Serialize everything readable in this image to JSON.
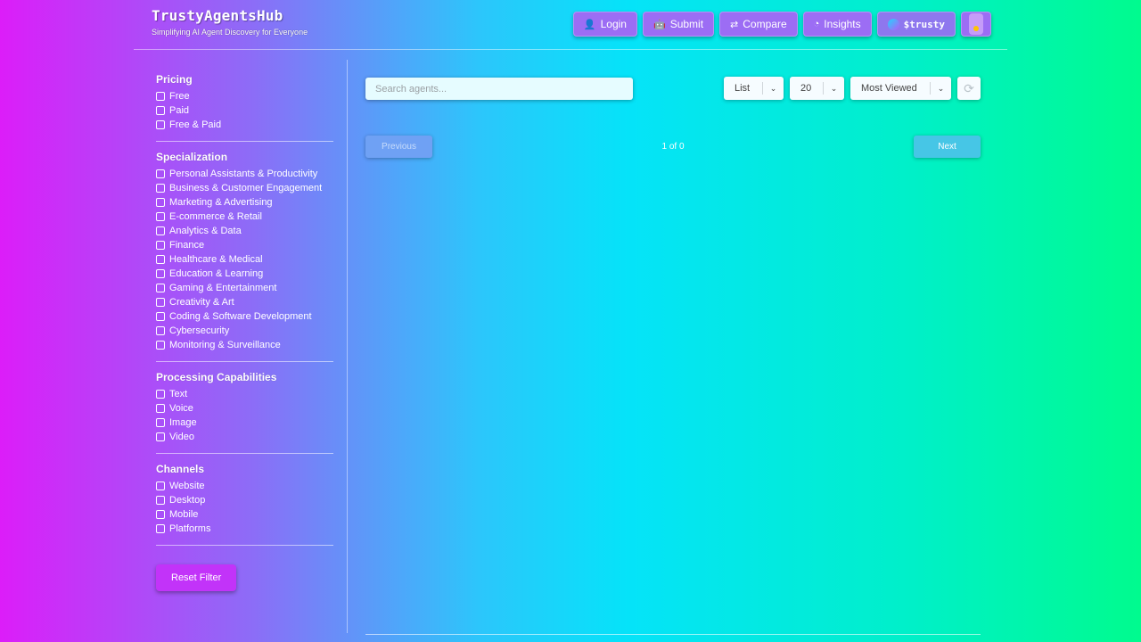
{
  "brand": {
    "title": "TrustyAgentsHub",
    "subtitle": "Simplifying AI Agent Discovery for Everyone"
  },
  "nav": {
    "login": "Login",
    "submit": "Submit",
    "compare": "Compare",
    "insights": "Insights",
    "trusty": "$trusty"
  },
  "filters": {
    "pricing": {
      "title": "Pricing",
      "options": [
        "Free",
        "Paid",
        "Free & Paid"
      ]
    },
    "specialization": {
      "title": "Specialization",
      "options": [
        "Personal Assistants & Productivity",
        "Business & Customer Engagement",
        "Marketing & Advertising",
        "E-commerce & Retail",
        "Analytics & Data",
        "Finance",
        "Healthcare & Medical",
        "Education & Learning",
        "Gaming & Entertainment",
        "Creativity & Art",
        "Coding & Software Development",
        "Cybersecurity",
        "Monitoring & Surveillance"
      ]
    },
    "processing": {
      "title": "Processing Capabilities",
      "options": [
        "Text",
        "Voice",
        "Image",
        "Video"
      ]
    },
    "channels": {
      "title": "Channels",
      "options": [
        "Website",
        "Desktop",
        "Mobile",
        "Platforms"
      ]
    },
    "reset": "Reset Filter"
  },
  "toolbar": {
    "search_placeholder": "Search agents...",
    "view": "List",
    "per_page": "20",
    "sort": "Most Viewed"
  },
  "pagination": {
    "previous": "Previous",
    "info": "1 of 0",
    "next": "Next"
  }
}
